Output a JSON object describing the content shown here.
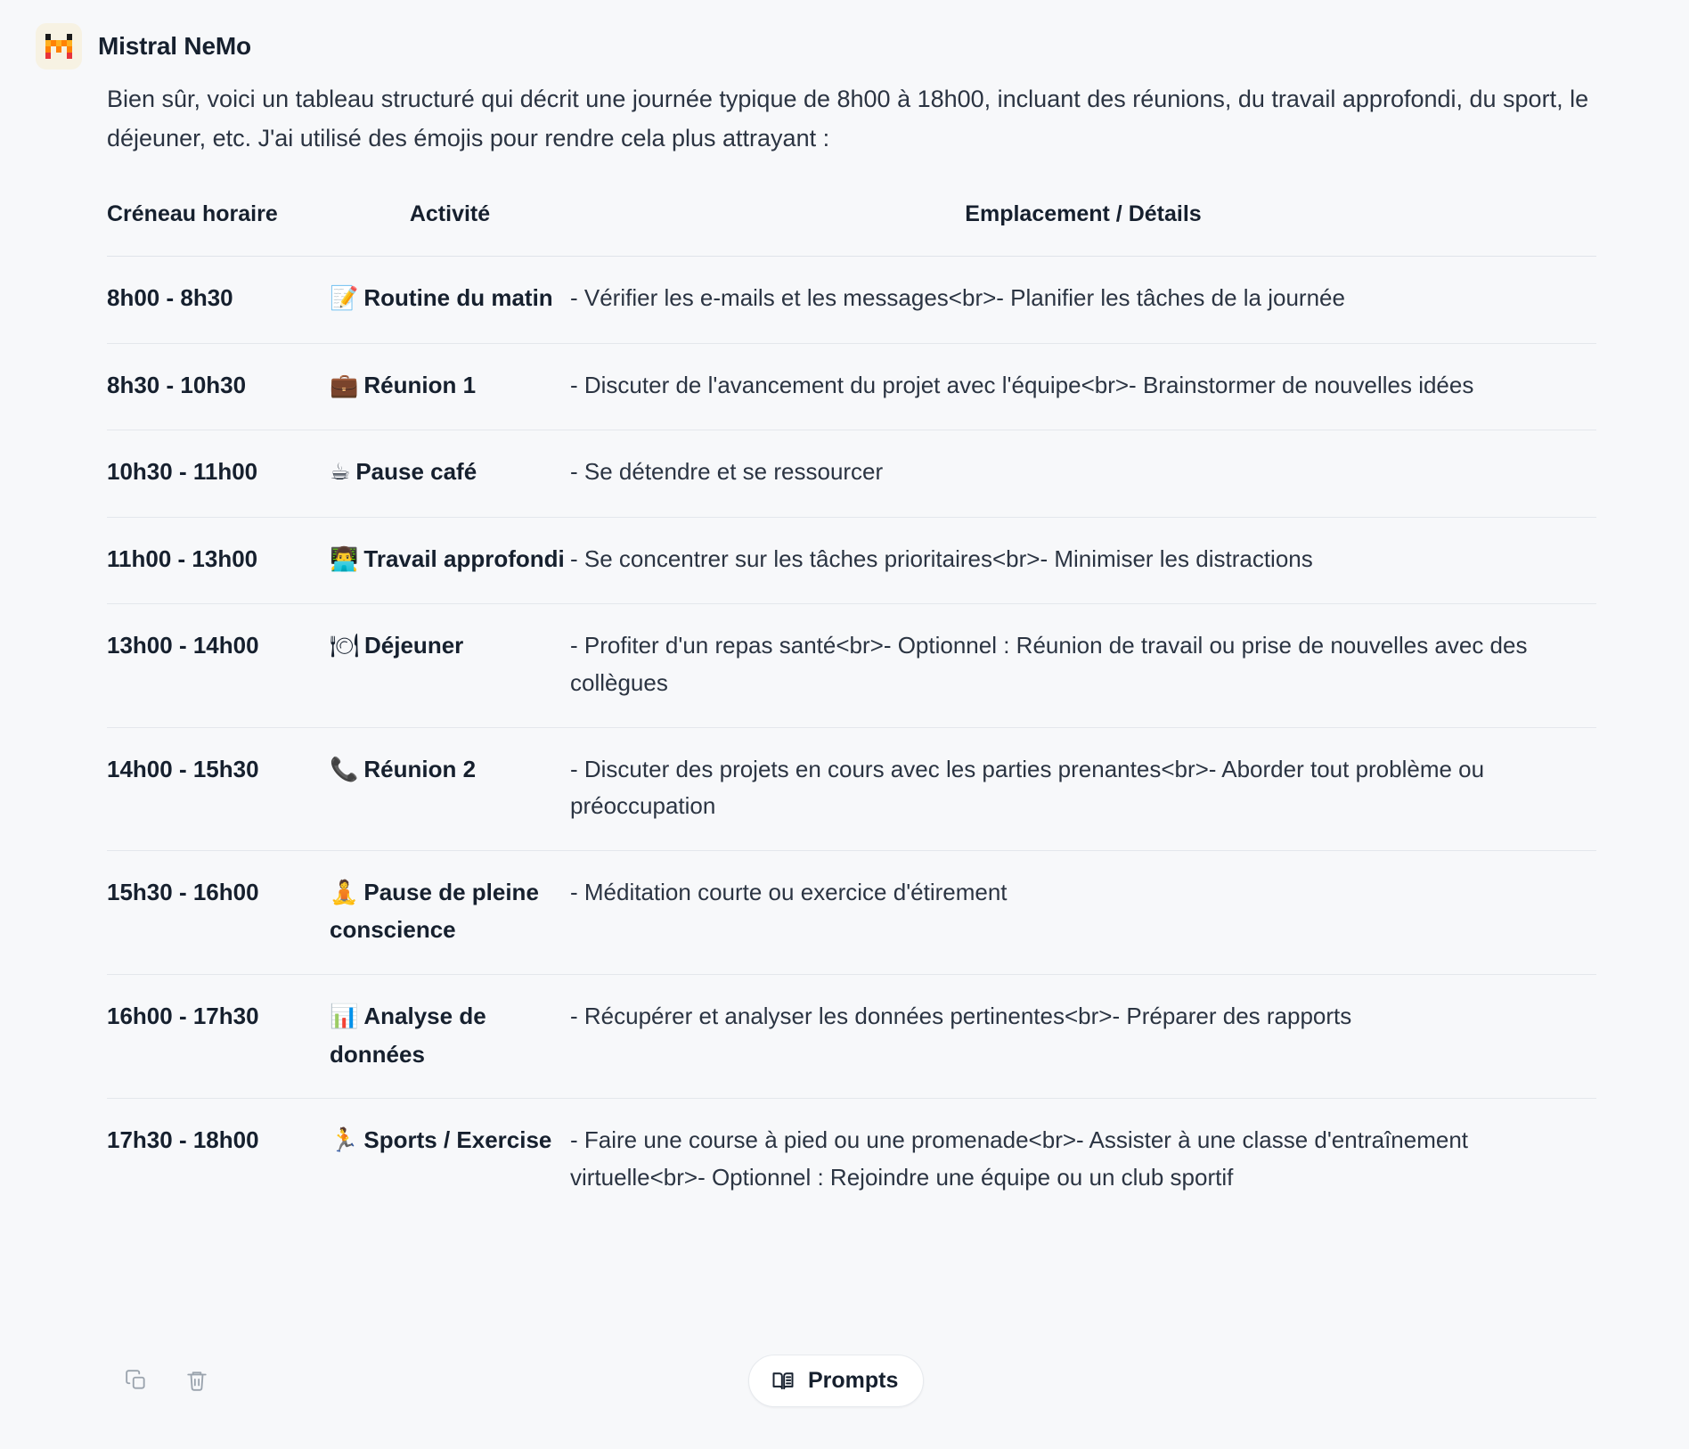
{
  "assistant": {
    "name": "Mistral NeMo",
    "avatar_icon": "mistral-logo-icon",
    "avatar_bg": "#f7f2e3",
    "logo_colors": [
      "#1a1a1a",
      "#ffb020",
      "#ff8205",
      "#ff4e21",
      "#e8333a"
    ]
  },
  "message": {
    "intro": "Bien sûr, voici un tableau structuré qui décrit une journée typique de 8h00 à 18h00, incluant des réunions, du travail approfondi, du sport, le déjeuner, etc. J'ai utilisé des émojis pour rendre cela plus attrayant :"
  },
  "table": {
    "headers": {
      "time": "Créneau horaire",
      "activity": "Activité",
      "details": "Emplacement / Détails"
    },
    "rows": [
      {
        "time": "8h00 - 8h30",
        "emoji": "📝",
        "emoji_name": "memo-emoji",
        "activity": "Routine du matin",
        "details": "- Vérifier les e-mails et les messages<br>- Planifier les tâches de la journée"
      },
      {
        "time": "8h30 - 10h30",
        "emoji": "💼",
        "emoji_name": "briefcase-emoji",
        "activity": "Réunion 1",
        "details": "- Discuter de l'avancement du projet avec l'équipe<br>- Brainstormer de nouvelles idées"
      },
      {
        "time": "10h30 - 11h00",
        "emoji": "☕",
        "emoji_name": "coffee-emoji",
        "activity": "Pause café",
        "details": "- Se détendre et se ressourcer"
      },
      {
        "time": "11h00 - 13h00",
        "emoji": "👨‍💻",
        "emoji_name": "technologist-emoji",
        "activity": "Travail approfondi",
        "details": "- Se concentrer sur les tâches prioritaires<br>- Minimiser les distractions"
      },
      {
        "time": "13h00 - 14h00",
        "emoji": "🍽",
        "emoji_name": "cutlery-emoji",
        "activity": "Déjeuner",
        "details": "- Profiter d'un repas santé<br>- Optionnel : Réunion de travail ou prise de nouvelles avec des collègues"
      },
      {
        "time": "14h00 - 15h30",
        "emoji": "📞",
        "emoji_name": "telephone-receiver-emoji",
        "activity": "Réunion 2",
        "details": "- Discuter des projets en cours avec les parties prenantes<br>- Aborder tout problème ou préoccupation"
      },
      {
        "time": "15h30 - 16h00",
        "emoji": "🧘",
        "emoji_name": "meditation-emoji",
        "activity": "Pause de pleine conscience",
        "details": "- Méditation courte ou exercice d'étirement"
      },
      {
        "time": "16h00 - 17h30",
        "emoji": "📊",
        "emoji_name": "bar-chart-emoji",
        "activity": "Analyse de données",
        "details": "- Récupérer et analyser les données pertinentes<br>- Préparer des rapports"
      },
      {
        "time": "17h30 - 18h00",
        "emoji": "🏃",
        "emoji_name": "runner-emoji",
        "activity": "Sports / Exercise",
        "details": "- Faire une course à pied ou une promenade<br>- Assister à une classe d'entraînement virtuelle<br>- Optionnel : Rejoindre une équipe ou un club sportif"
      }
    ]
  },
  "footer": {
    "copy_icon": "copy-icon",
    "delete_icon": "trash-icon",
    "prompts_label": "Prompts",
    "prompts_icon": "open-book-icon"
  },
  "theme": {
    "background": "#f7f8fa",
    "text": "#1c2536",
    "muted_text": "#2b3442",
    "divider": "#e4e7ec",
    "button_bg": "#ffffff",
    "button_border": "#e7eaee"
  }
}
